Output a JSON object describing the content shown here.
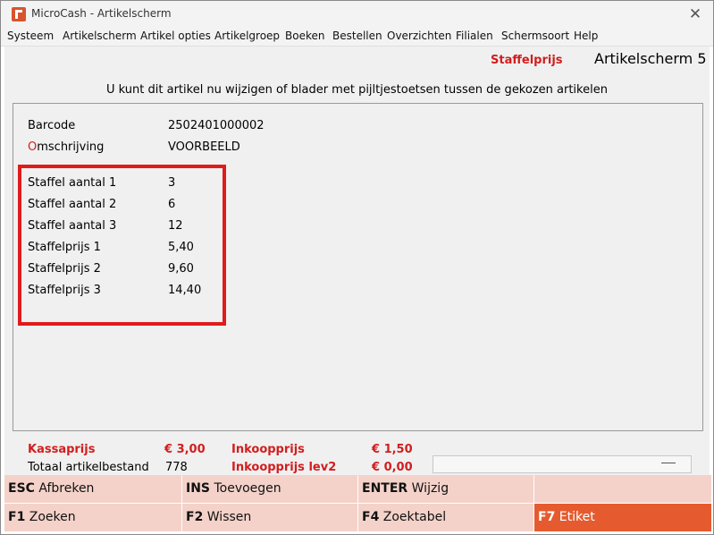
{
  "window": {
    "title": "MicroCash - Artikelscherm",
    "close_glyph": "✕"
  },
  "menu": [
    "Systeem",
    "Artikelscherm",
    "Artikel opties",
    "Artikelgroep",
    "Boeken",
    "Bestellen",
    "Overzichten",
    "Filialen",
    "Schermsoort",
    "Help"
  ],
  "header": {
    "mode_label": "Staffelprijs",
    "screen_title": "Artikelscherm 5",
    "instruction": "U kunt dit artikel nu wijzigen of blader met pijltjestoetsen tussen de gekozen artikelen"
  },
  "article": {
    "barcode_label": "Barcode",
    "barcode": "2502401000002",
    "description_first": "O",
    "description_rest": "mschrijving",
    "description": "VOORBEELD"
  },
  "staffel": [
    {
      "label": "Staffel aantal 1",
      "value": "3"
    },
    {
      "label": "Staffel aantal 2",
      "value": "6"
    },
    {
      "label": "Staffel aantal 3",
      "value": "12"
    },
    {
      "label": "Staffelprijs 1",
      "value": "5,40"
    },
    {
      "label": "Staffelprijs 2",
      "value": "9,60"
    },
    {
      "label": "Staffelprijs 3",
      "value": "14,40"
    }
  ],
  "footer": {
    "kassaprijs_label": "Kassaprijs",
    "kassaprijs": "€ 3,00",
    "inkoopprijs_label": "Inkoopprijs",
    "inkoopprijs": "€ 1,50",
    "voorraad_label": "Totaal artikelbestand",
    "voorraad": "778",
    "inkoop_lev2_label": "Inkoopprijs lev2",
    "inkoop_lev2": "€ 0,00"
  },
  "fkeys": [
    {
      "key": "ESC",
      "label": "Afbreken"
    },
    {
      "key": "INS",
      "label": "Toevoegen"
    },
    {
      "key": "ENTER",
      "label": "Wijzig"
    },
    {
      "key": "",
      "label": ""
    },
    {
      "key": "F1",
      "label": "Zoeken"
    },
    {
      "key": "F2",
      "label": "Wissen"
    },
    {
      "key": "F4",
      "label": "Zoektabel"
    },
    {
      "key": "F7",
      "label": "Etiket"
    }
  ],
  "colors": {
    "accent_red": "#d11e1e",
    "fkey_bg": "#f4d2c9",
    "fkey_active": "#e55b2f"
  },
  "icons": {
    "app": "microcash-logo-icon",
    "close": "close-icon"
  }
}
